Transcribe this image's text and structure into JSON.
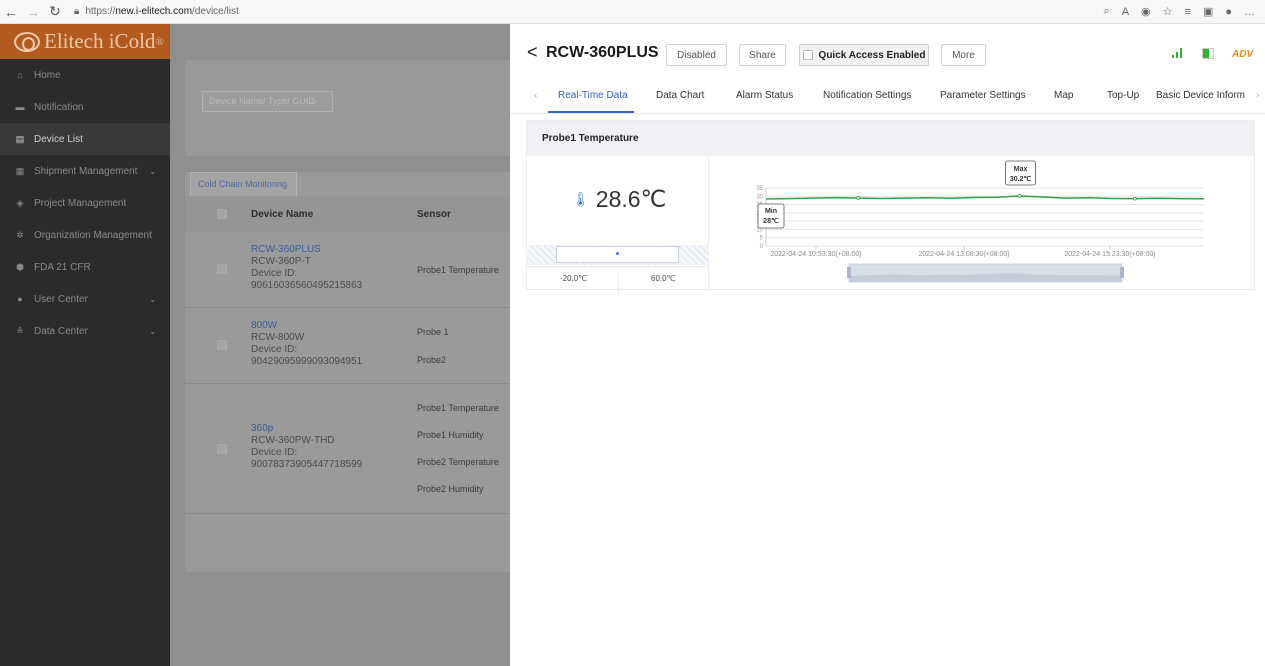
{
  "browser": {
    "url_prefix": "https://",
    "url_host": "new.i-elitech.com",
    "url_path": "/device/list"
  },
  "app": {
    "brand": "Elitech iCold",
    "brand_mark": "®"
  },
  "sidebar": {
    "items": [
      {
        "label": "Home",
        "icon": "home-icon"
      },
      {
        "label": "Notification",
        "icon": "message-icon"
      },
      {
        "label": "Device List",
        "icon": "device-icon"
      },
      {
        "label": "Shipment Management",
        "icon": "shipment-icon"
      },
      {
        "label": "Project Management",
        "icon": "layers-icon"
      },
      {
        "label": "Organization Management",
        "icon": "organization-icon"
      },
      {
        "label": "FDA 21 CFR",
        "icon": "shield-icon"
      },
      {
        "label": "User Center",
        "icon": "user-icon"
      },
      {
        "label": "Data Center",
        "icon": "database-icon"
      }
    ]
  },
  "list": {
    "search_placeholder": "Device Name/ Type/ GUID",
    "tab": "Cold Chain Monitoring",
    "col_device": "Device Name",
    "col_sensor": "Sensor",
    "rows": [
      {
        "name": "RCW-360PLUS",
        "model": "RCW-360P-T",
        "id_label": "Device ID:",
        "id": "90616036560495215863",
        "sensors": [
          "Probe1 Temperature"
        ]
      },
      {
        "name": "800W",
        "model": "RCW-800W",
        "id_label": "Device ID:",
        "id": "90429095999093094951",
        "sensors": [
          "Probe 1",
          "Probe2"
        ]
      },
      {
        "name": "360p",
        "model": "RCW-360PW-THD",
        "id_label": "Device ID:",
        "id": "90078373905447718599",
        "sensors": [
          "Probe1 Temperature",
          "Probe1 Humidity",
          "Probe2 Temperature",
          "Probe2 Humidity"
        ]
      }
    ]
  },
  "drawer": {
    "title": "RCW-360PLUS",
    "btn_disabled": "Disabled",
    "btn_share": "Share",
    "btn_quick_access": "Quick Access Enabled",
    "btn_more": "More",
    "badge": "ADV",
    "tabs": [
      "Real-Time Data",
      "Data Chart",
      "Alarm Status",
      "Notification Settings",
      "Parameter Settings",
      "Map",
      "Top-Up",
      "Basic Device Inform"
    ],
    "probe_title": "Probe1 Temperature",
    "current_temp": "28.6℃",
    "range_min": "-20.0℃",
    "range_max": "60.0℃"
  },
  "chart_data": {
    "type": "line",
    "x_labels": [
      "2022-04-24 10:53:30(+08:00)",
      "2022-04-24 13:08:30(+08:00)",
      "2022-04-24 15:23:30(+08:00)"
    ],
    "yticks": [
      0,
      5,
      10,
      15,
      20,
      25,
      30,
      35
    ],
    "ylim": [
      0,
      35
    ],
    "series": [
      {
        "values": [
          28.4,
          28.6,
          28.9,
          29.2,
          29.0,
          28.7,
          28.9,
          29.1,
          28.8,
          29.3,
          29.4,
          30.2,
          29.6,
          28.9,
          29.1,
          28.7,
          28.6,
          28.8,
          28.6,
          28.5
        ]
      }
    ],
    "annotations": {
      "max_label": "Max",
      "max_value": "30.2℃",
      "min_label": "Min",
      "min_value": "28℃"
    },
    "line_color": "#2ea043"
  }
}
